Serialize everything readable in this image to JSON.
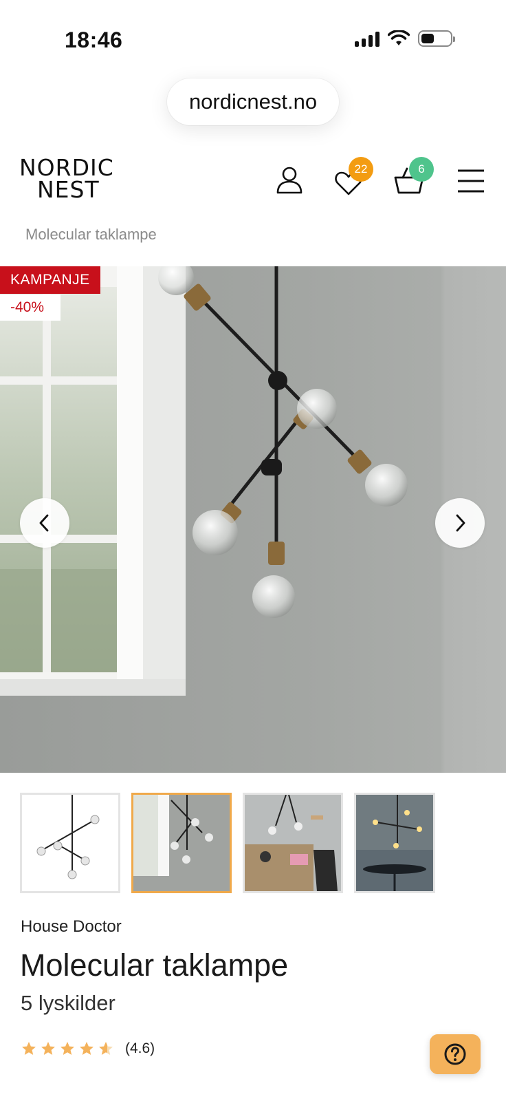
{
  "status_bar": {
    "time": "18:46",
    "battery_level": 0.45
  },
  "browser": {
    "url": "nordicnest.no"
  },
  "header": {
    "logo_line1": "NORDIC",
    "logo_line2": "NEST",
    "wishlist_count": "22",
    "cart_count": "6",
    "wishlist_badge_color": "#f39c12",
    "cart_badge_color": "#4fc48c",
    "icons": [
      "account-icon",
      "heart-icon",
      "basket-icon",
      "menu-icon"
    ]
  },
  "breadcrumb": {
    "current": "Molecular taklampe"
  },
  "hero": {
    "campaign_label": "KAMPANJE",
    "discount_label": "-40%",
    "campaign_color": "#c8101b"
  },
  "gallery": {
    "thumbnail_count": 4,
    "active_index": 1,
    "active_border_color": "#f0a94a"
  },
  "product": {
    "brand": "House Doctor",
    "title": "Molecular taklampe",
    "subtitle": "5 lyskilder",
    "rating_value": 4.6,
    "rating_text": "(4.6)",
    "star_color": "#f4b25b"
  },
  "help_button": {
    "icon": "question-icon",
    "color": "#f4b25b"
  }
}
